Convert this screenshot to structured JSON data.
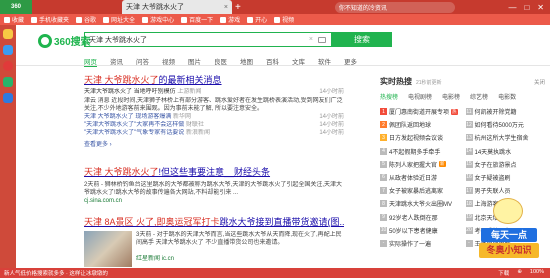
{
  "browser": {
    "logo_text": "360",
    "tab_title": "天津 大爷跳水火了",
    "tab_close": "×",
    "tab_new": "+",
    "top_search_placeholder": "你不知道的冷资讯",
    "win_controls": [
      "—",
      "□",
      "✕"
    ],
    "bookmarks": [
      "收藏",
      "手机收藏夹",
      "谷歌",
      "网址大全",
      "游戏中心",
      "百度一下",
      "游戏",
      "开心",
      "视频"
    ]
  },
  "search": {
    "brand": "360搜索",
    "query": "天津 大爷跳水火了",
    "button": "搜索",
    "tabs": [
      "网页",
      "资讯",
      "问答",
      "视频",
      "图片",
      "良医",
      "地图",
      "百科",
      "文库",
      "软件",
      "更多"
    ]
  },
  "results": [
    {
      "title_pre": "天津 大爷跳水火了",
      "title_post": "的最新相关消息",
      "news_text": "天津大爷跳水火了 当地呼吁别模仿",
      "news_source": "上游新闻",
      "news_time": "14小时前",
      "snippet": "津云 消息 近段时间,天津狮子林桥上有部分游客、跳水爱好者在发生跳桥表演活动,受到网友们广泛关注,不少外地游客前来围观。因为事前未能了解, 所以要注意安全。",
      "sublinks": [
        {
          "text": "天津 大爷跳水火了 现场游客爆满",
          "source": "新华网",
          "time": "14小时前"
        },
        {
          "text": "\"天津大爷跳水火了\"大家再不会这样做",
          "source": "财联社",
          "time": "14小时前"
        },
        {
          "text": "\"天津大爷跳水火了\"气象专家有话要说",
          "source": "新浪新闻",
          "time": "14小时前"
        }
      ],
      "more": "查看更多 ›"
    },
    {
      "title_pre": "天津 大爷跳水火了",
      "title_post": "!但这些事要注意__财经头条",
      "snippet": "2天前 - 狮林桥钓鱼台这里跳水的大爷都被称为跳水大爷,天津的大爷跳水火了引起全国关注,天津大爷跳水火了!跳水大爷的故事传遍各大网站,不料却能引来 ...",
      "url": "cj.sina.com.cn"
    },
    {
      "title_pre": "天津 8A景区 火了,即奥运冠军打卡",
      "title_post": "跳水大爷接到直播带货邀请(图...",
      "snippet": "3天前 - 对于跳水的天津大爷而言,当这些跳水大爷从天而降,现在火了,再配上民间高手 天津大爷跳水火了 不少直播带货公司也来邀请。",
      "url": "红星新闻  ic.cn"
    }
  ],
  "hot": {
    "title": "实时热搜",
    "subtitle": "21秒前更新",
    "close": "关闭",
    "tabs": [
      "热搜榜",
      "电视剧榜",
      "电影榜",
      "综艺榜",
      "电影数"
    ],
    "items": [
      {
        "rank": "1",
        "text": "厦门惠南街道开展专项",
        "badge": "热"
      },
      {
        "rank": "11",
        "text": "何凯被开除党籍",
        "badge": ""
      },
      {
        "rank": "2",
        "text": "佩团队返回地球",
        "badge": ""
      },
      {
        "rank": "12",
        "text": "如何看待5000万元",
        "badge": ""
      },
      {
        "rank": "3",
        "text": "日方发起视频会议谈",
        "badge": ""
      },
      {
        "rank": "13",
        "text": "杭州这所大学生宿舍",
        "badge": ""
      },
      {
        "rank": "4",
        "text": "4不起假期多手牵手",
        "badge": ""
      },
      {
        "rank": "14",
        "text": "14天莫执跳水",
        "badge": ""
      },
      {
        "rank": "5",
        "text": "陈列人家把握大官",
        "badge": "新"
      },
      {
        "rank": "15",
        "text": "女子在旅游景点",
        "badge": ""
      },
      {
        "rank": "6",
        "text": "从政者体验近日游",
        "badge": ""
      },
      {
        "rank": "16",
        "text": "女子疑被盗刷",
        "badge": ""
      },
      {
        "rank": "7",
        "text": "女子被家暴后逃离家",
        "badge": ""
      },
      {
        "rank": "17",
        "text": "男子失联人员",
        "badge": ""
      },
      {
        "rank": "8",
        "text": "天津跳水大爷火出圈MV",
        "badge": ""
      },
      {
        "rank": "18",
        "text": "上海游客数量",
        "badge": ""
      },
      {
        "rank": "9",
        "text": "92岁老人跌倒在那",
        "badge": ""
      },
      {
        "rank": "19",
        "text": "北京天坛公园",
        "badge": ""
      },
      {
        "rank": "10",
        "text": "50岁以下患者健康",
        "badge": ""
      },
      {
        "rank": "20",
        "text": "考研成绩公布",
        "badge": ""
      },
      {
        "rank": "-",
        "text": "实际操作了一遍",
        "badge": ""
      },
      {
        "rank": "-",
        "text": "王者荣耀更新",
        "badge": ""
      }
    ]
  },
  "mascot": {
    "line1": "每天一点",
    "line2": "冬奥小知识"
  },
  "status": {
    "left": "新人气低价格搜索就多多 · 这样让冰墩墩的",
    "right": [
      "下载",
      "⊕",
      "100%"
    ]
  },
  "colors": {
    "accent": "#21b34f",
    "link": "#1a0dab",
    "highlight": "#d93025",
    "topbar": "#c63a2e"
  }
}
